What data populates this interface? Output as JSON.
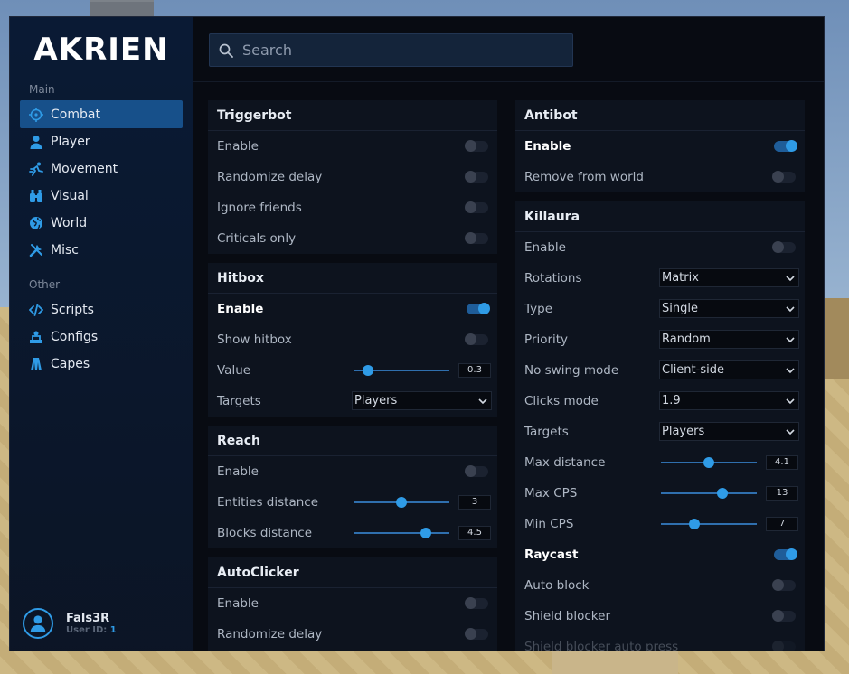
{
  "brand": "AKRIEN",
  "search": {
    "placeholder": "Search"
  },
  "sidebar": {
    "section_main": "Main",
    "section_other": "Other",
    "items": [
      {
        "label": "Combat",
        "icon": "crosshair-icon",
        "active": true
      },
      {
        "label": "Player",
        "icon": "person-icon"
      },
      {
        "label": "Movement",
        "icon": "running-icon"
      },
      {
        "label": "Visual",
        "icon": "binoculars-icon"
      },
      {
        "label": "World",
        "icon": "globe-icon"
      },
      {
        "label": "Misc",
        "icon": "tools-icon"
      },
      {
        "label": "Scripts",
        "icon": "code-icon"
      },
      {
        "label": "Configs",
        "icon": "configs-icon"
      },
      {
        "label": "Capes",
        "icon": "cape-icon"
      }
    ]
  },
  "user": {
    "name": "Fals3R",
    "id_label": "User ID:",
    "id": "1"
  },
  "colors": {
    "accent": "#2f9be6",
    "active_nav": "#17508a",
    "panel": "#0d131e",
    "window": "#080b12"
  },
  "panels": {
    "triggerbot": {
      "title": "Triggerbot",
      "rows": [
        {
          "label": "Enable",
          "on": false
        },
        {
          "label": "Randomize delay",
          "on": false
        },
        {
          "label": "Ignore friends",
          "on": false
        },
        {
          "label": "Criticals only",
          "on": false
        }
      ]
    },
    "hitbox": {
      "title": "Hitbox",
      "enable": "Enable",
      "enable_on": true,
      "show": "Show hitbox",
      "show_on": false,
      "value_label": "Value",
      "value": "0.3",
      "value_fraction": 0.15,
      "targets_label": "Targets",
      "targets": "Players"
    },
    "reach": {
      "title": "Reach",
      "enable": "Enable",
      "enable_on": false,
      "entities_label": "Entities distance",
      "entities": "3",
      "entities_fraction": 0.5,
      "blocks_label": "Blocks distance",
      "blocks": "4.5",
      "blocks_fraction": 0.75
    },
    "autoclicker": {
      "title": "AutoClicker",
      "enable": "Enable",
      "randomize": "Randomize delay"
    },
    "antibot": {
      "title": "Antibot",
      "enable": "Enable",
      "enable_on": true,
      "remove": "Remove from world",
      "remove_on": false
    },
    "killaura": {
      "title": "Killaura",
      "enable": "Enable",
      "rotations_label": "Rotations",
      "rotations": "Matrix",
      "type_label": "Type",
      "type": "Single",
      "priority_label": "Priority",
      "priority": "Random",
      "noswing_label": "No swing mode",
      "noswing": "Client-side",
      "clicks_label": "Clicks mode",
      "clicks": "1.9",
      "targets_label": "Targets",
      "targets": "Players",
      "maxdist_label": "Max distance",
      "maxdist": "4.1",
      "maxdist_fraction": 0.5,
      "maxcps_label": "Max CPS",
      "maxcps": "13",
      "maxcps_fraction": 0.64,
      "mincps_label": "Min CPS",
      "mincps": "7",
      "mincps_fraction": 0.35,
      "raycast_label": "Raycast",
      "raycast_on": true,
      "autoblock_label": "Auto block",
      "shield_label": "Shield blocker",
      "shieldauto_label": "Shield blocker auto press"
    }
  }
}
